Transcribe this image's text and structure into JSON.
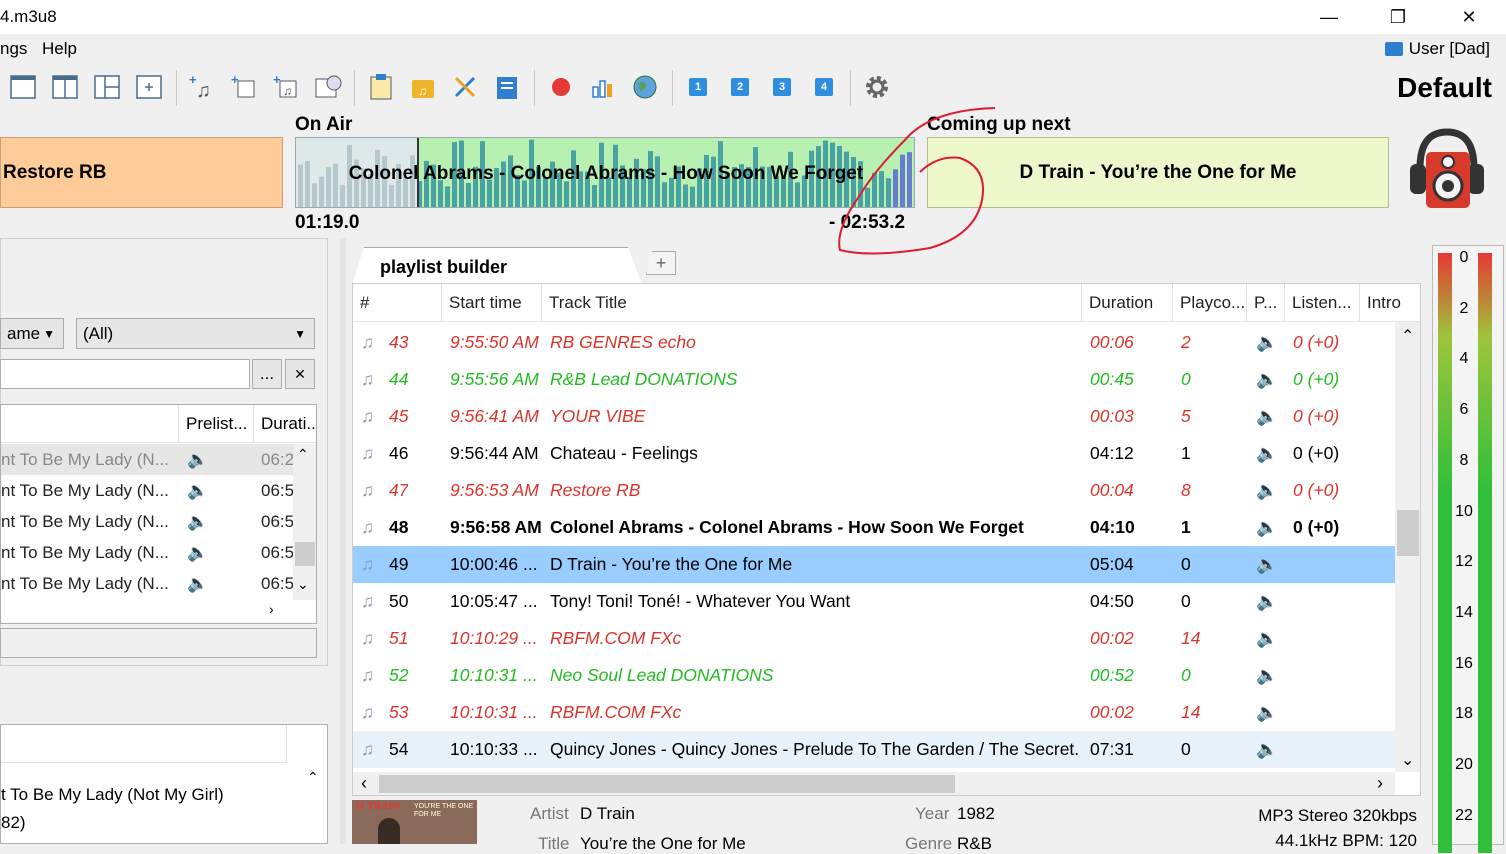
{
  "window": {
    "title": "4.m3u8"
  },
  "menu": {
    "items": [
      "ngs",
      "Help"
    ]
  },
  "user": {
    "label": "User [Dad]"
  },
  "profile": {
    "name": "Default"
  },
  "toolbar": {
    "numbers": [
      "1",
      "2",
      "3",
      "4"
    ]
  },
  "onair": {
    "heading": "On Air",
    "prev_title": "Restore RB",
    "current_title": "Colonel Abrams - Colonel Abrams - How Soon We Forget",
    "elapsed": "01:19.0",
    "remaining": "- 02:53.2",
    "progress_fraction": 0.31
  },
  "next": {
    "heading": "Coming up next",
    "title": "D Train - You’re the One for Me"
  },
  "left_panel": {
    "filter_label": "ame",
    "filter_value": "(All)",
    "btn_browse": "...",
    "btn_clear": "✕",
    "columns": [
      "Prelist...",
      "Durati..."
    ],
    "rows": [
      {
        "title": "nt To Be My Lady (N...",
        "duration": "06:2"
      },
      {
        "title": "nt To Be My Lady (N...",
        "duration": "06:5"
      },
      {
        "title": "nt To Be My Lady (N...",
        "duration": "06:5"
      },
      {
        "title": "nt To Be My Lady (N...",
        "duration": "06:5"
      },
      {
        "title": "nt To Be My Lady (N...",
        "duration": "06:5"
      }
    ],
    "detail_line1": "t To Be My Lady (Not My Girl)",
    "detail_line2": "82)"
  },
  "tab": {
    "label": "playlist builder",
    "add_label": "+"
  },
  "grid": {
    "columns": [
      "#",
      "Start time",
      "Track Title",
      "Duration",
      "Playco...",
      "P...",
      "Listen...",
      "Intro"
    ],
    "rows": [
      {
        "num": "43",
        "start": "9:55:50 AM",
        "title": "RB GENRES echo",
        "duration": "00:06",
        "plays": "2",
        "listen": "0 (+0)",
        "style": "red"
      },
      {
        "num": "44",
        "start": "9:55:56 AM",
        "title": "R&B Lead DONATIONS",
        "duration": "00:45",
        "plays": "0",
        "listen": "0 (+0)",
        "style": "green"
      },
      {
        "num": "45",
        "start": "9:56:41 AM",
        "title": "YOUR VIBE",
        "duration": "00:03",
        "plays": "5",
        "listen": "0 (+0)",
        "style": "red"
      },
      {
        "num": "46",
        "start": "9:56:44 AM",
        "title": "Chateau - Feelings",
        "duration": "04:12",
        "plays": "1",
        "listen": "0 (+0)",
        "style": "normal"
      },
      {
        "num": "47",
        "start": "9:56:53 AM",
        "title": "Restore RB",
        "duration": "00:04",
        "plays": "8",
        "listen": "0 (+0)",
        "style": "red"
      },
      {
        "num": "48",
        "start": "9:56:58 AM",
        "title": "Colonel Abrams - Colonel Abrams - How Soon We Forget",
        "duration": "04:10",
        "plays": "1",
        "listen": "0 (+0)",
        "style": "bold"
      },
      {
        "num": "49",
        "start": "10:00:46 ...",
        "title": "D Train - You’re the One for Me",
        "duration": "05:04",
        "plays": "0",
        "listen": "",
        "style": "sel"
      },
      {
        "num": "50",
        "start": "10:05:47 ...",
        "title": "Tony! Toni! Toné! - Whatever You Want",
        "duration": "04:50",
        "plays": "0",
        "listen": "",
        "style": "normal"
      },
      {
        "num": "51",
        "start": "10:10:29 ...",
        "title": "RBFM.COM FXc",
        "duration": "00:02",
        "plays": "14",
        "listen": "",
        "style": "red"
      },
      {
        "num": "52",
        "start": "10:10:31 ...",
        "title": "Neo Soul Lead DONATIONS",
        "duration": "00:52",
        "plays": "0",
        "listen": "",
        "style": "green"
      },
      {
        "num": "53",
        "start": "10:10:31 ...",
        "title": "RBFM.COM FXc",
        "duration": "00:02",
        "plays": "14",
        "listen": "",
        "style": "red"
      },
      {
        "num": "54",
        "start": "10:10:33 ...",
        "title": "Quincy Jones - Quincy Jones - Prelude To The Garden / The Secret...",
        "duration": "07:31",
        "plays": "0",
        "listen": "",
        "style": "hl"
      }
    ]
  },
  "info": {
    "artist_label": "Artist",
    "artist": "D Train",
    "year_label": "Year",
    "year": "1982",
    "title_label": "Title",
    "title": "You’re the One for Me",
    "genre_label": "Genre",
    "genre": "R&B",
    "format": "MP3 Stereo 320kbps",
    "format2": "44.1kHz  BPM: 120",
    "art_caption": "YOU'RE THE ONE FOR ME"
  },
  "meter": {
    "labels": [
      "0",
      "2",
      "4",
      "6",
      "8",
      "10",
      "12",
      "14",
      "16",
      "18",
      "20",
      "22"
    ]
  },
  "colors": {
    "red": "#d9342c",
    "green": "#22bb22",
    "selection": "#99ccff",
    "prev": "#ffcc99",
    "next": "#eef6cc"
  }
}
